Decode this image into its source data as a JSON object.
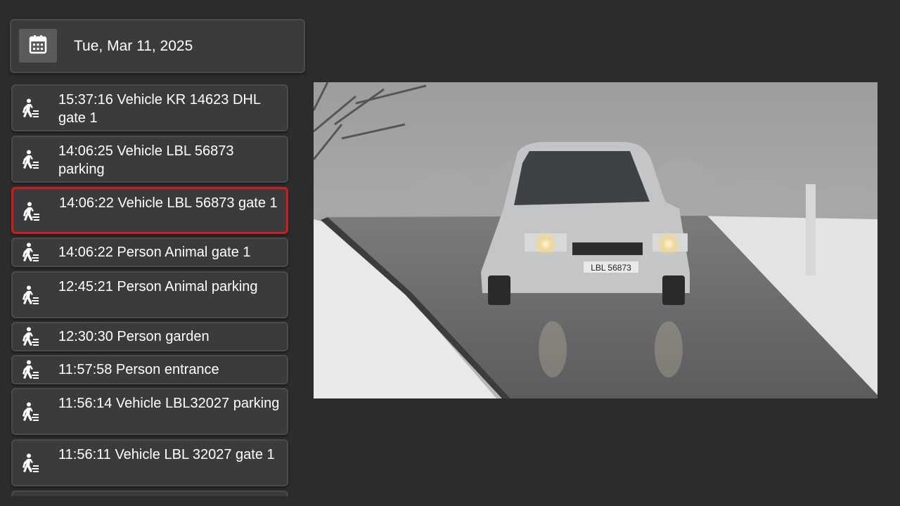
{
  "date_picker": {
    "icon": "calendar-icon",
    "date": "Tue, Mar 11, 2025"
  },
  "events": [
    {
      "icon": "person-walking-icon",
      "text": "15:37:16 Vehicle KR 14623 DHL gate 1",
      "selected": false
    },
    {
      "icon": "person-walking-icon",
      "text": "14:06:25 Vehicle LBL 56873 parking",
      "selected": false
    },
    {
      "icon": "person-walking-icon",
      "text": "14:06:22 Vehicle LBL 56873 gate 1",
      "selected": true
    },
    {
      "icon": "person-walking-icon",
      "text": "14:06:22 Person Animal gate 1",
      "selected": false
    },
    {
      "icon": "person-walking-icon",
      "text": "12:45:21 Person Animal parking",
      "selected": false
    },
    {
      "icon": "person-walking-icon",
      "text": "12:30:30 Person garden",
      "selected": false
    },
    {
      "icon": "person-walking-icon",
      "text": "11:57:58 Person entrance",
      "selected": false
    },
    {
      "icon": "person-walking-icon",
      "text": "11:56:14 Vehicle LBL32027 parking",
      "selected": false
    },
    {
      "icon": "person-walking-icon",
      "text": "11:56:11 Vehicle LBL 32027 gate 1",
      "selected": false
    }
  ],
  "camera": {
    "plate_text": "LBL 56873"
  },
  "colors": {
    "background": "#2b2c2e",
    "card": "#3a3b3d",
    "selected_border": "#d11c1c"
  }
}
